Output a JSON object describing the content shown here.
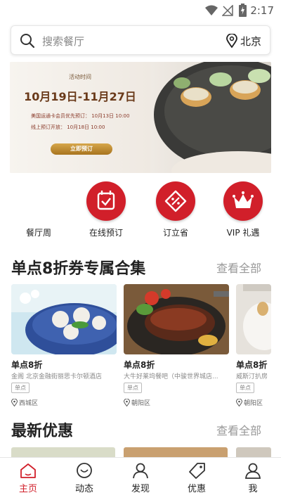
{
  "status": {
    "time": "2:17"
  },
  "search": {
    "placeholder": "搜索餐厅",
    "city": "北京"
  },
  "banner": {
    "activity_label": "活动时间",
    "dates": "10月19日-11月27日",
    "line1": "美国运通卡会员优先预订：  10月13日 10:00",
    "line2": "线上预订开放：        10月18日 10:00",
    "button": "立即预订",
    "active_dot": 1
  },
  "categories": [
    {
      "label": "餐厅周",
      "icon": "calendar-check-icon"
    },
    {
      "label": "在线预订",
      "icon": "calendar-check-icon"
    },
    {
      "label": "订立省",
      "icon": "discount-tag-icon"
    },
    {
      "label": "VIP 礼遇",
      "icon": "crown-icon"
    }
  ],
  "section1": {
    "title": "单点8折券专属合集",
    "see_all": "查看全部"
  },
  "cards": [
    {
      "title": "单点8折",
      "subtitle": "金阁 北京金融街丽思卡尔顿酒店",
      "badge": "单点",
      "district": "西城区"
    },
    {
      "title": "单点8折",
      "subtitle": "大牛好莱坞餐吧（中骏世界城店...",
      "badge": "单点",
      "district": "朝阳区"
    },
    {
      "title": "单点8折",
      "subtitle": "威斯汀扒房",
      "badge": "单点",
      "district": "朝阳区"
    }
  ],
  "section2": {
    "title": "最新优惠",
    "see_all": "查看全部"
  },
  "tabs": [
    {
      "label": "主页",
      "icon": "home-icon",
      "active": true
    },
    {
      "label": "动态",
      "icon": "feed-icon",
      "active": false
    },
    {
      "label": "发现",
      "icon": "discover-icon",
      "active": false
    },
    {
      "label": "优惠",
      "icon": "tag-icon",
      "active": false
    },
    {
      "label": "我",
      "icon": "profile-icon",
      "active": false
    }
  ],
  "colors": {
    "accent": "#d11f2a"
  }
}
